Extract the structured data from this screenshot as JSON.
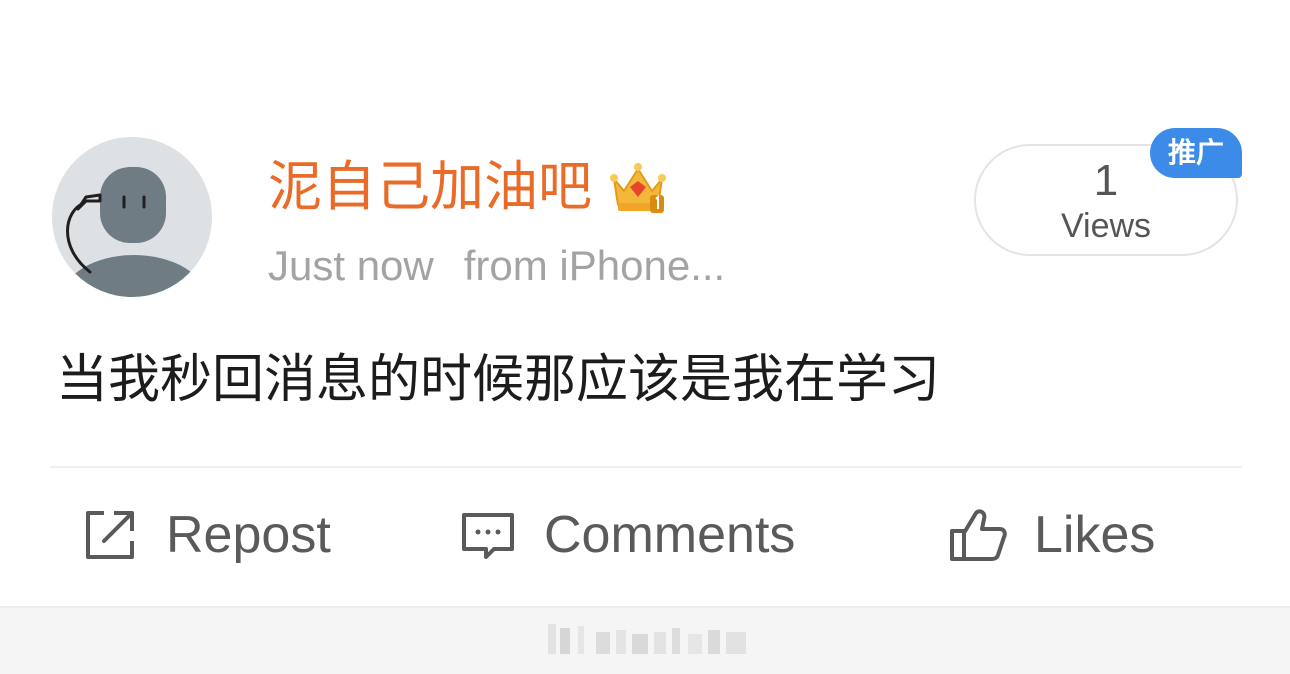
{
  "post": {
    "username": "泥自己加油吧",
    "timestamp": "Just now",
    "source": "from iPhone...",
    "content": "当我秒回消息的时候那应该是我在学习",
    "badge_icon": "crown-icon"
  },
  "views": {
    "count": "1",
    "label": "Views",
    "promo_tag": "推广",
    "promo_color": "#3d8be8"
  },
  "actions": {
    "repost_label": "Repost",
    "comments_label": "Comments",
    "likes_label": "Likes"
  },
  "colors": {
    "username": "#ea6b28",
    "meta_text": "#a3a3a3",
    "body_text": "#1c1c1c",
    "action_text": "#5a5a5a"
  }
}
